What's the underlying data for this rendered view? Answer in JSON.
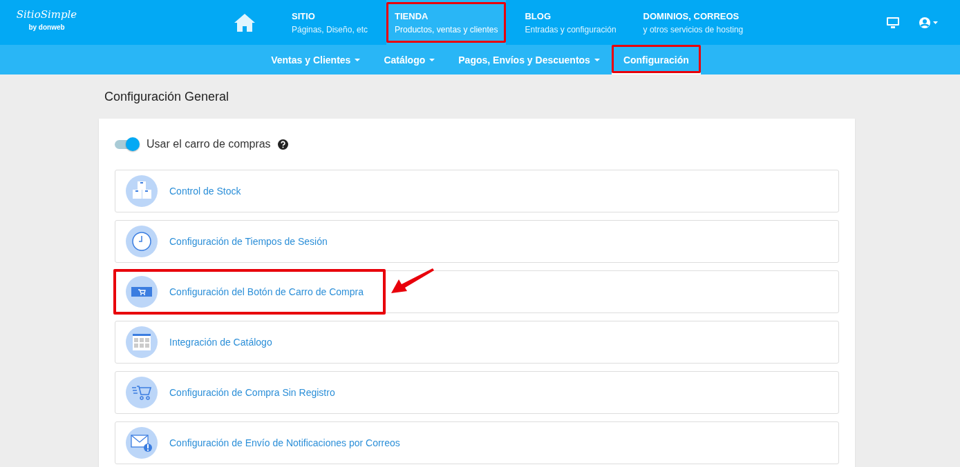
{
  "logo": {
    "name": "SitioSimple",
    "byline": "by donweb"
  },
  "nav": [
    {
      "title": "SITIO",
      "subtitle": "Páginas, Diseño, etc",
      "selected": false,
      "highlighted": false
    },
    {
      "title": "TIENDA",
      "subtitle": "Productos, ventas y clientes",
      "selected": true,
      "highlighted": true
    },
    {
      "title": "BLOG",
      "subtitle": "Entradas y configuración",
      "selected": false,
      "highlighted": false
    },
    {
      "title": "DOMINIOS, CORREOS",
      "subtitle": "y otros servicios de hosting",
      "selected": false,
      "highlighted": false
    }
  ],
  "subnav": [
    {
      "label": "Ventas y Clientes",
      "dropdown": true,
      "selected": false,
      "highlighted": false
    },
    {
      "label": "Catálogo",
      "dropdown": true,
      "selected": false,
      "highlighted": false
    },
    {
      "label": "Pagos, Envíos y Descuentos",
      "dropdown": true,
      "selected": false,
      "highlighted": false
    },
    {
      "label": "Configuración",
      "dropdown": false,
      "selected": true,
      "highlighted": true
    }
  ],
  "page_title": "Configuración General",
  "cart_toggle": {
    "label": "Usar el carro de compras",
    "on": true
  },
  "options": [
    {
      "kind": "boxes",
      "label": "Control de Stock",
      "highlighted": false
    },
    {
      "kind": "clock",
      "label": "Configuración de Tiempos de Sesión",
      "highlighted": false
    },
    {
      "kind": "cart-button",
      "label": "Configuración del Botón de Carro de Compra",
      "highlighted": true
    },
    {
      "kind": "table",
      "label": "Integración de Catálogo",
      "highlighted": false
    },
    {
      "kind": "cart",
      "label": "Configuración de Compra Sin Registro",
      "highlighted": false
    },
    {
      "kind": "mail",
      "label": "Configuración de Envío de Notificaciones por Correos",
      "highlighted": false
    }
  ]
}
